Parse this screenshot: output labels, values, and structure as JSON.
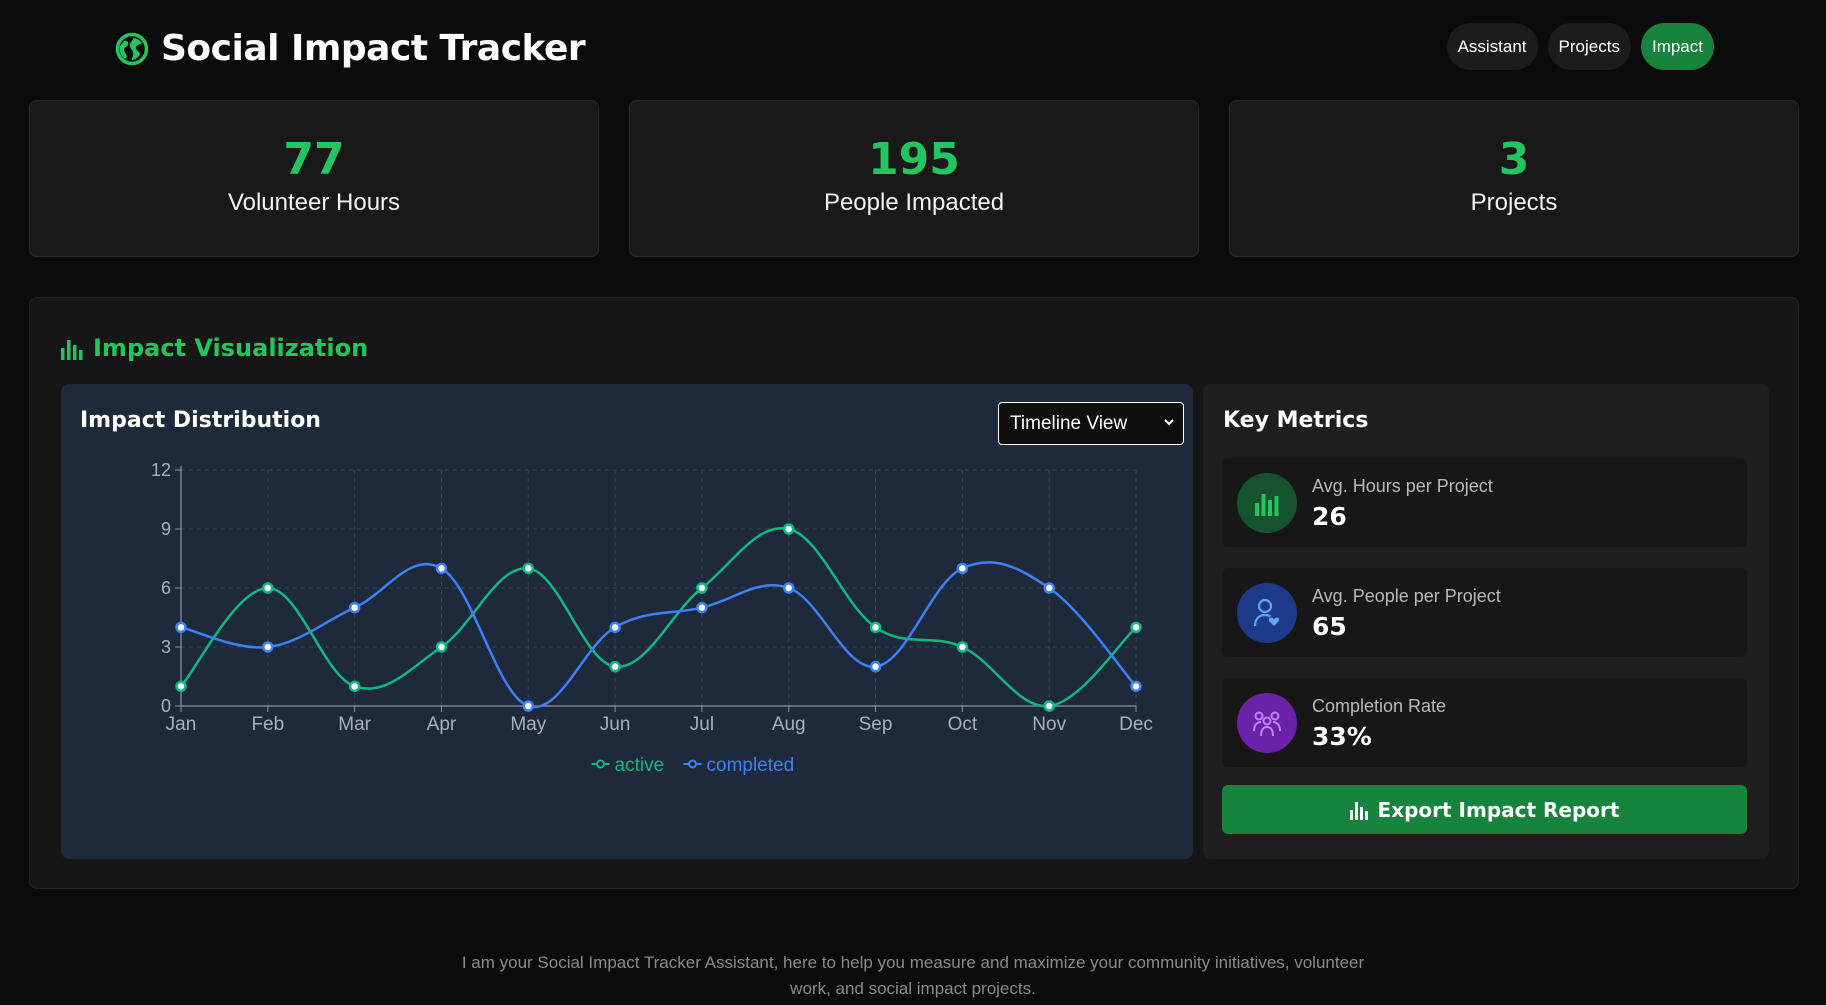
{
  "header": {
    "title": "Social Impact Tracker",
    "icon": "globe-icon",
    "nav": [
      {
        "label": "Assistant",
        "active": false
      },
      {
        "label": "Projects",
        "active": false
      },
      {
        "label": "Impact",
        "active": true
      }
    ]
  },
  "stats": [
    {
      "value": "77",
      "label": "Volunteer Hours"
    },
    {
      "value": "195",
      "label": "People Impacted"
    },
    {
      "value": "3",
      "label": "Projects"
    }
  ],
  "visualization": {
    "title": "Impact Visualization",
    "icon": "bar-chart-icon",
    "chart_card_title": "Impact Distribution",
    "view_select": "Timeline View"
  },
  "chart_data": {
    "type": "line",
    "title": "",
    "xlabel": "",
    "ylabel": "",
    "x": [
      "Jan",
      "Feb",
      "Mar",
      "Apr",
      "May",
      "Jun",
      "Jul",
      "Aug",
      "Sep",
      "Oct",
      "Nov",
      "Dec"
    ],
    "ylim": [
      0,
      12
    ],
    "yticks": [
      0,
      3,
      6,
      9,
      12
    ],
    "grid": true,
    "legend": "bottom-center",
    "series": [
      {
        "name": "active",
        "color": "#10b981",
        "values": [
          1,
          6,
          1,
          3,
          7,
          2,
          6,
          9,
          4,
          3,
          0,
          4
        ]
      },
      {
        "name": "completed",
        "color": "#3b82f6",
        "values": [
          4,
          3,
          5,
          7,
          0,
          4,
          5,
          6,
          2,
          7,
          6,
          1
        ]
      }
    ]
  },
  "metrics": {
    "title": "Key Metrics",
    "items": [
      {
        "label": "Avg. Hours per Project",
        "value": "26",
        "icon": "bar-chart-icon",
        "color": "#16a34a"
      },
      {
        "label": "Avg. People per Project",
        "value": "65",
        "icon": "user-heart-icon",
        "color": "#3b82f6"
      },
      {
        "label": "Completion Rate",
        "value": "33%",
        "icon": "people-group-icon",
        "color": "#a855f7"
      }
    ],
    "export_label": "Export Impact Report"
  },
  "footer": {
    "text_line1": "I am your Social Impact Tracker Assistant, here to help you measure and maximize your community initiatives, volunteer",
    "text_line2": "work, and social impact projects."
  }
}
